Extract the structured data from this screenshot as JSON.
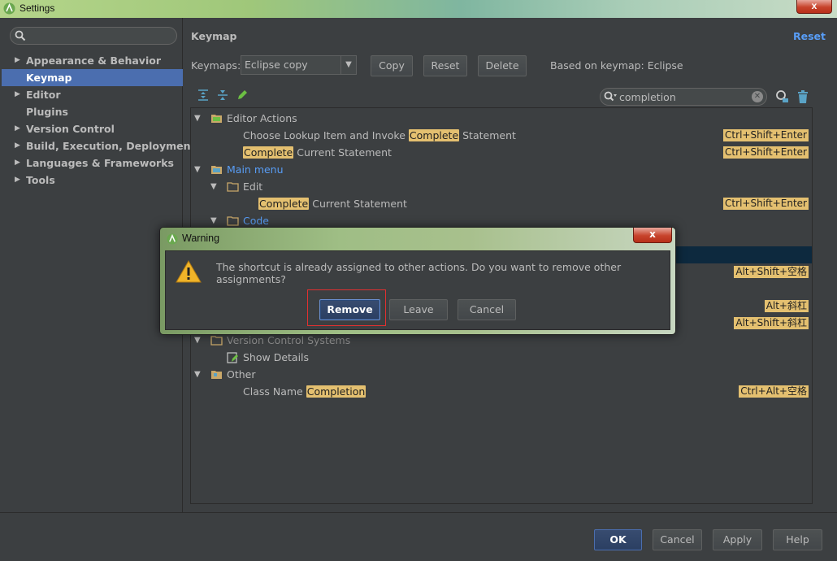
{
  "window": {
    "title": "Settings",
    "close_label": "x"
  },
  "left": {
    "search_placeholder": "",
    "items": [
      {
        "label": "Appearance & Behavior",
        "expandable": true
      },
      {
        "label": "Keymap",
        "expandable": false,
        "selected": true
      },
      {
        "label": "Editor",
        "expandable": true
      },
      {
        "label": "Plugins",
        "expandable": false
      },
      {
        "label": "Version Control",
        "expandable": true
      },
      {
        "label": "Build, Execution, Deployment",
        "expandable": true
      },
      {
        "label": "Languages & Frameworks",
        "expandable": true
      },
      {
        "label": "Tools",
        "expandable": true
      }
    ]
  },
  "keymap": {
    "title": "Keymap",
    "reset_link": "Reset",
    "keymaps_label": "Keymaps:",
    "selected_keymap": "Eclipse copy",
    "copy_btn": "Copy",
    "reset_btn": "Reset",
    "delete_btn": "Delete",
    "based_on": "Based on keymap: Eclipse",
    "filter_value": "completion"
  },
  "tree": {
    "editor_actions": "Editor Actions",
    "r1_pre": "Choose Lookup Item and Invoke ",
    "r1_hl": "Complete",
    "r1_post": " Statement",
    "r1_sc": "Ctrl+Shift+Enter",
    "r2_hl": "Complete",
    "r2_post": " Current Statement",
    "r2_sc": "Ctrl+Shift+Enter",
    "main_menu": "Main menu",
    "edit": "Edit",
    "r3_hl": "Complete",
    "r3_post": " Current Statement",
    "r3_sc": "Ctrl+Shift+Enter",
    "code": "Code",
    "sc_a": "Alt+Shift+空格",
    "sc_b": "Alt+斜杠",
    "sc_c": "Alt+Shift+斜杠",
    "vcs": "Version Control Systems",
    "show_details": "Show Details",
    "other": "Other",
    "r4_pre": "Class Name ",
    "r4_hl": "Completion",
    "r4_sc": "Ctrl+Alt+空格"
  },
  "bottom": {
    "ok": "OK",
    "cancel": "Cancel",
    "apply": "Apply",
    "help": "Help"
  },
  "dialog": {
    "title": "Warning",
    "close_label": "x",
    "message": "The shortcut is already assigned to other actions. Do you want to remove other assignments?",
    "remove": "Remove",
    "leave": "Leave",
    "cancel": "Cancel"
  }
}
